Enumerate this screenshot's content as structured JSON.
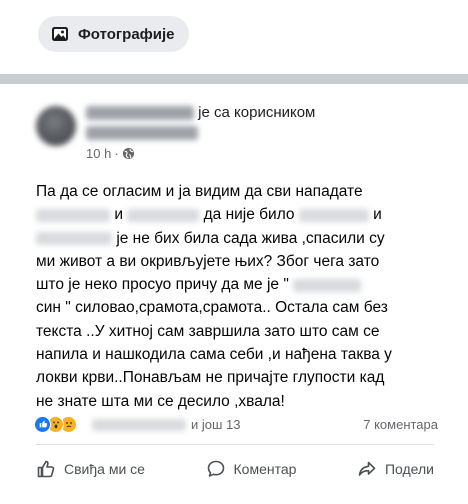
{
  "top": {
    "photos_label": "Фотографије",
    "photos_icon": "photo-icon"
  },
  "post": {
    "author_blurred": "Надица Марко",
    "with_text": "је са корисником",
    "tagged_blurred": "Анабела Малер",
    "time": "10 h",
    "dot": "·",
    "privacy_icon": "globe-icon",
    "more_icon": "more-dots-icon",
    "body": {
      "l1": "Па да се огласим и ја видим да сви нападате",
      "l2_mid": "и",
      "l2_end": "да није било",
      "l2_tail": "и",
      "l3": "је не бих била сада жива ,спасили су",
      "l4": "ми живот а ви окривљујете њих? Због чега зато",
      "l5_start": "што је неко просуо причу да ме је \"",
      "l6": "син \" силовао,срамота,срамота.. Остала сам без",
      "l7": "текста ..У хитној сам завршила зато што сам се",
      "l8": "напила и нашкодила сама себи ,и нађена таква у",
      "l9": "локви крви..Понављам не причајте глупости кад",
      "l10": "не знате шта ми се десило ,хвала!"
    },
    "reactions": {
      "icons": [
        "like-icon",
        "wow-icon",
        "sad-icon"
      ],
      "name_blurred": "Анабела Малер",
      "and_more": "и још 13",
      "comments": "7 коментара"
    },
    "actions": {
      "like": "Свиђа ми се",
      "comment": "Коментар",
      "share": "Подели"
    }
  },
  "colors": {
    "accent": "#1877f2",
    "separator": "#c9ccd1",
    "chip_bg": "#e9ebef",
    "muted_text": "#65676b"
  }
}
